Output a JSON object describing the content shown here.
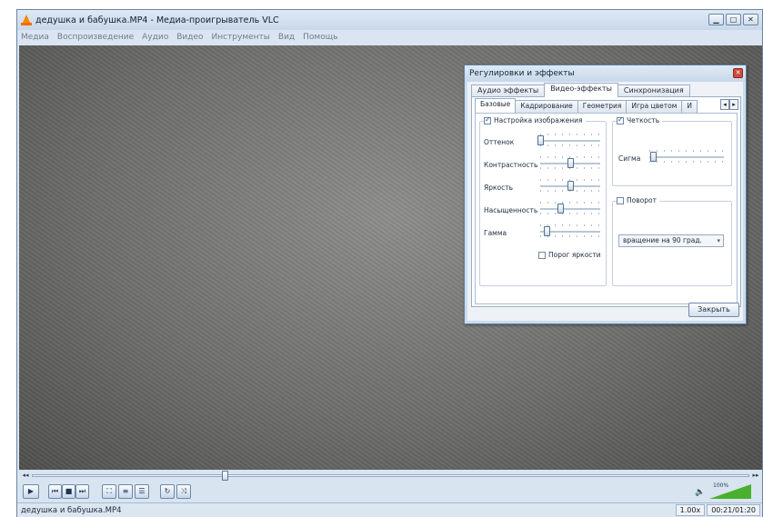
{
  "window": {
    "title": "дедушка и бабушка.MP4 - Медиа-проигрыватель VLC",
    "buttons": {
      "minimize": "▁",
      "maximize": "□",
      "close": "✕"
    }
  },
  "menu": [
    "Медиа",
    "Воспроизведение",
    "Аудио",
    "Видео",
    "Инструменты",
    "Вид",
    "Помощь"
  ],
  "player": {
    "seek_position": 0.27,
    "volume_percent": "100%",
    "volume_level": 1.0,
    "speed": "1.00x",
    "time": "00:21/01:20",
    "filename": "дедушка и бабушка.MP4"
  },
  "controls": {
    "play": "▶",
    "prev": "⏮",
    "stop": "■",
    "next": "⏭",
    "fullscreen": "⛶",
    "extended": "≡",
    "playlist": "☰",
    "loop": "↻",
    "random": "⤨",
    "seek_back": "◂◂",
    "seek_fwd": "▸▸",
    "volume_icon": "🔈"
  },
  "dialog": {
    "title": "Регулировки и эффекты",
    "close_icon": "✕",
    "tabs": [
      "Аудио эффекты",
      "Видео-эффекты",
      "Синхронизация"
    ],
    "active_tab": 1,
    "subtabs": [
      "Базовые",
      "Кадрирование",
      "Геометрия",
      "Игра цветом",
      "И"
    ],
    "active_subtab": 0,
    "image_adjust": {
      "label": "Настройка изображения",
      "checked": true,
      "sliders": [
        {
          "label": "Оттенок",
          "level": 0.0
        },
        {
          "label": "Контрастность",
          "level": 0.5
        },
        {
          "label": "Яркость",
          "level": 0.5
        },
        {
          "label": "Насыщенность",
          "level": 0.33
        },
        {
          "label": "Гамма",
          "level": 0.1
        }
      ],
      "brightness_threshold": {
        "label": "Порог яркости",
        "checked": false
      }
    },
    "sharpen": {
      "label": "Четкость",
      "checked": true,
      "slider": {
        "label": "Сигма",
        "level": 0.05
      }
    },
    "rotate": {
      "label": "Поворот",
      "checked": false,
      "value": "вращение на 90 град."
    },
    "close_button": "Закрыть"
  }
}
